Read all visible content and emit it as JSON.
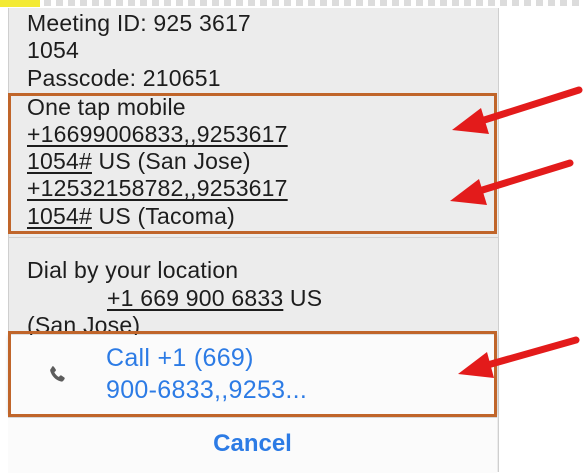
{
  "meeting_info": {
    "meeting_id_line1": "Meeting ID: 925 3617",
    "meeting_id_line2": "1054",
    "passcode": "Passcode: 210651"
  },
  "one_tap": {
    "heading": "One tap mobile",
    "entries": [
      {
        "number_part1": "+16699006833,,9253617",
        "number_part2": "1054#",
        "location": " US (San Jose)"
      },
      {
        "number_part1": "+12532158782,,9253617",
        "number_part2": "1054#",
        "location": " US (Tacoma)"
      }
    ]
  },
  "dial_by_location": {
    "heading": "Dial by your location",
    "number": "+1 669 900 6833",
    "country": " US",
    "city": "(San Jose)"
  },
  "call_action": {
    "line1": "Call +1 (669)",
    "line2": "900-6833,,9253...",
    "icon": "phone-icon"
  },
  "cancel_label": "Cancel",
  "colors": {
    "accent_blue": "#2c7be5",
    "highlight_box": "#c0652a",
    "arrow_red": "#e31b1b",
    "panel_gray": "#ececec"
  }
}
